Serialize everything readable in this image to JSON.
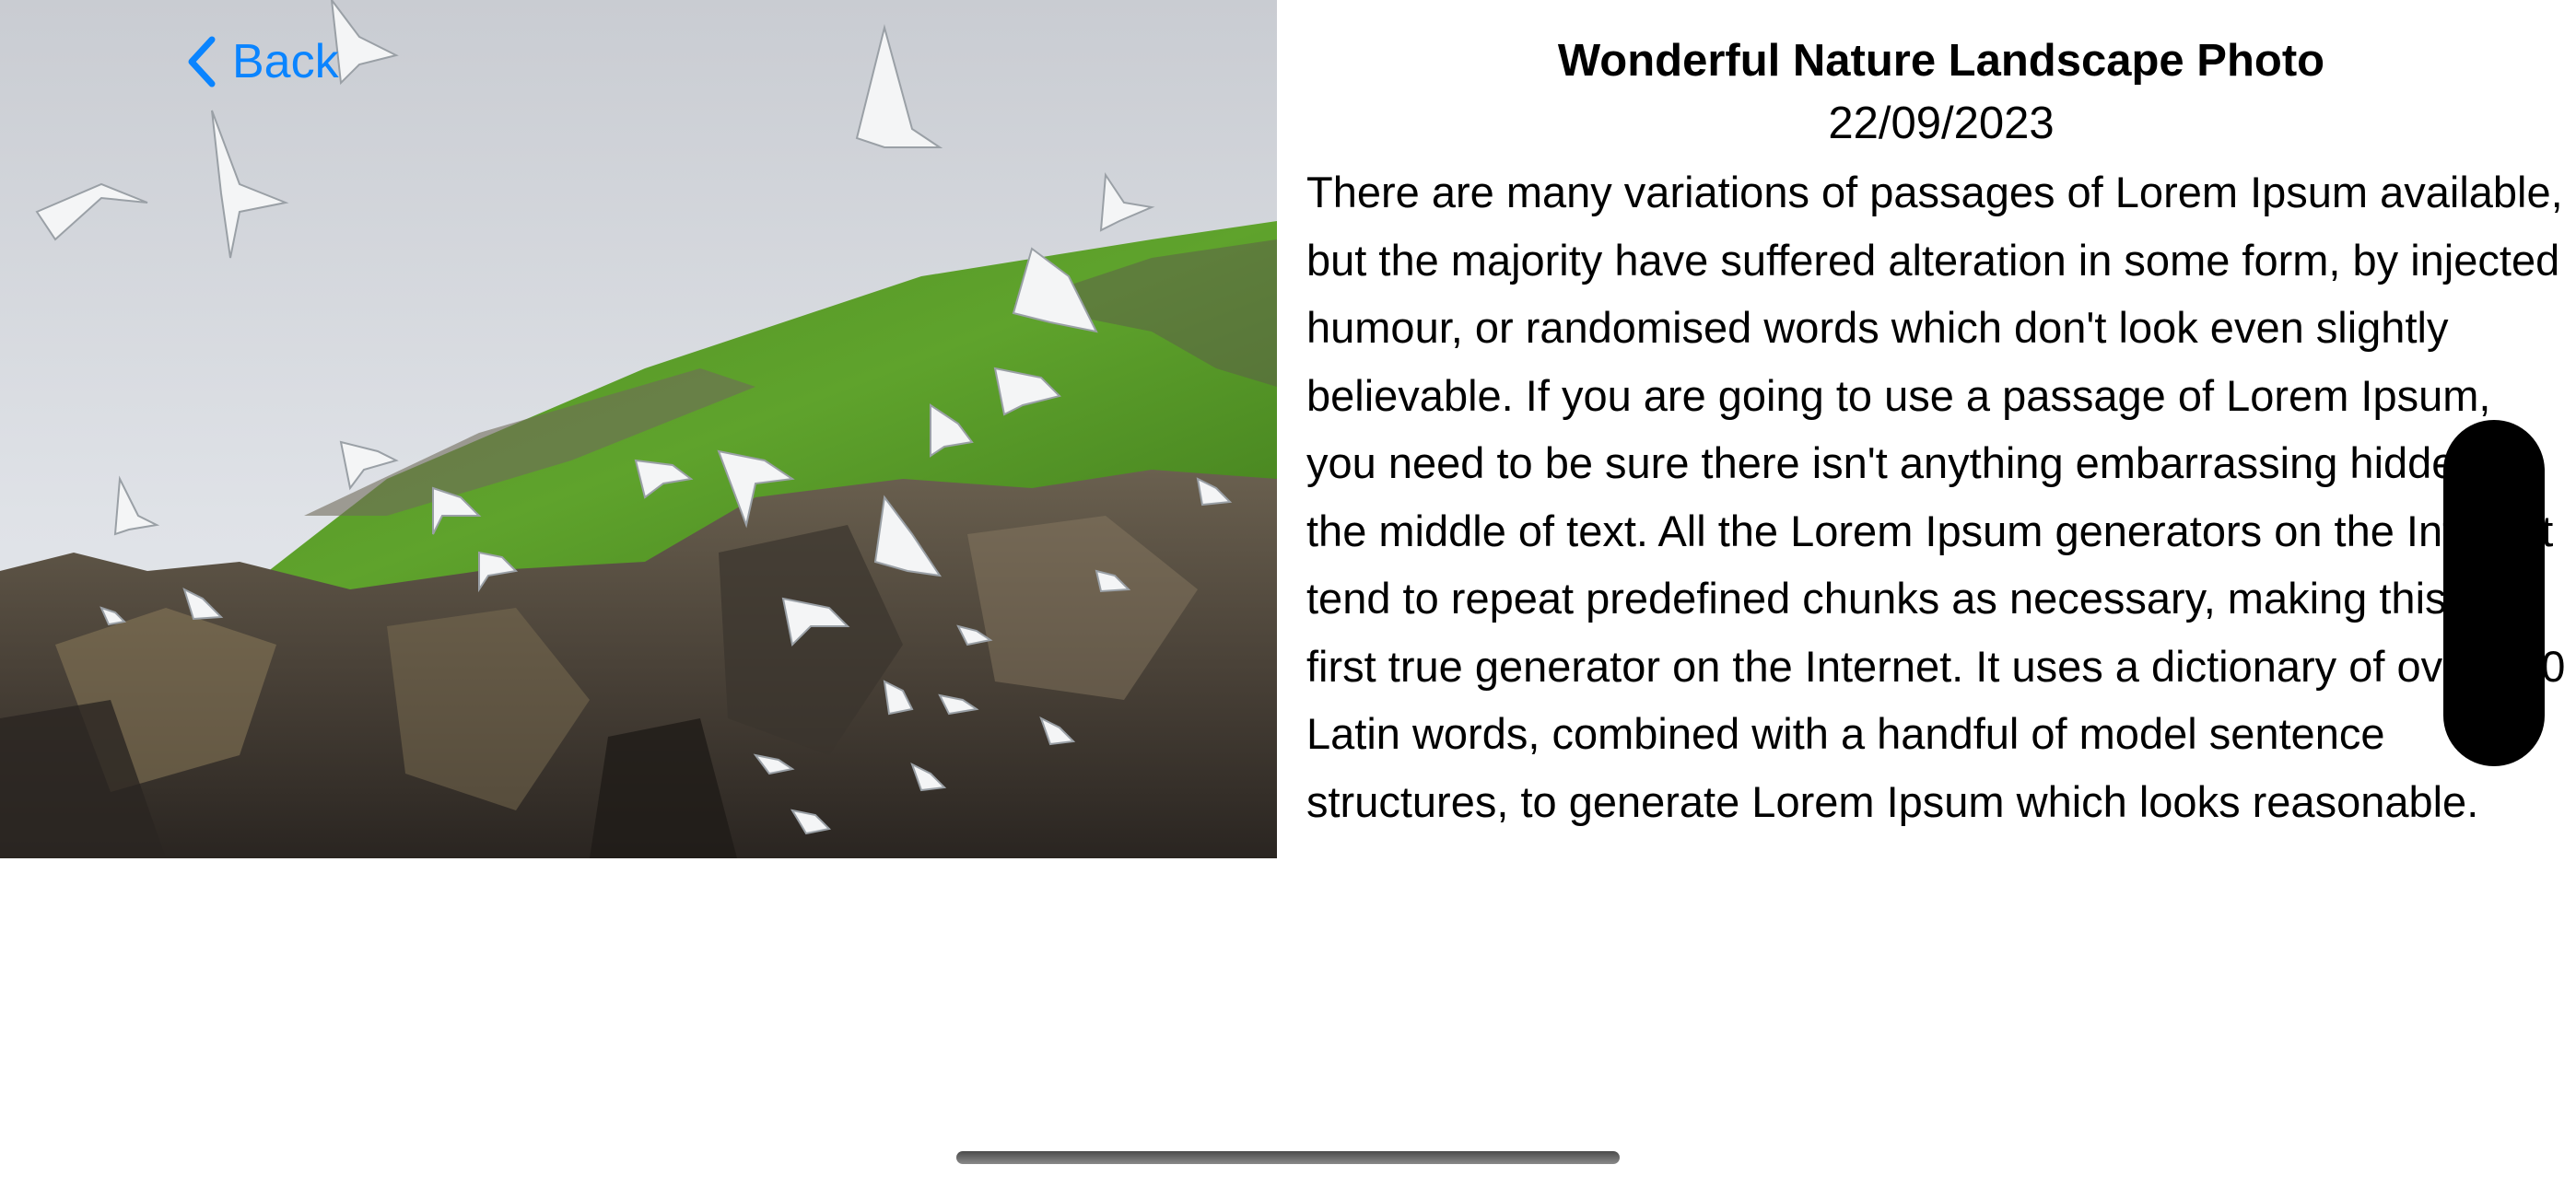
{
  "navigation": {
    "back_label": "Back"
  },
  "photo": {
    "subject": "seagulls over rocky cliffs and green hillside"
  },
  "detail": {
    "title": "Wonderful Nature Landscape Photo",
    "date": "22/09/2023",
    "description": "There are many variations of passages of Lorem Ipsum available, but the majority have suffered alteration in some form, by injected humour, or randomised words which don't look even slightly believable. If you are going to use a passage of Lorem Ipsum, you need to be sure there isn't anything embarrassing hidden in the middle of text. All the Lorem Ipsum generators on the Internet tend to repeat predefined chunks as necessary, making this the first true generator on the Internet. It uses a dictionary of over 200 Latin words, combined with a handful of model sentence structures, to generate Lorem Ipsum which looks reasonable."
  },
  "colors": {
    "accent": "#0a84ff",
    "text": "#000000",
    "background": "#ffffff"
  },
  "icons": {
    "back": "chevron-left-icon"
  }
}
